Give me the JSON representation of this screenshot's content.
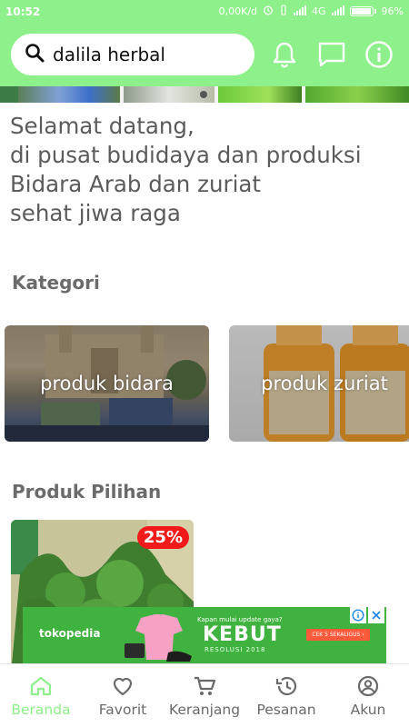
{
  "status_bar": {
    "time": "10:52",
    "network_speed": "0,00K/d",
    "network_type": "4G",
    "battery": "96%",
    "battery_level": 0.96
  },
  "app_bar": {
    "search_value": "dalila herbal",
    "icons": [
      "search-icon",
      "bell-icon",
      "chat-icon",
      "info-icon"
    ]
  },
  "welcome_text": "Selamat datang,\ndi pusat budidaya dan produksi\nBidara Arab dan zuriat\nsehat jiwa raga",
  "kategori": {
    "title": "Kategori",
    "items": [
      {
        "label": "produk bidara"
      },
      {
        "label": "produk zuriat"
      }
    ]
  },
  "produk_pilihan": {
    "title": "Produk Pilihan",
    "items": [
      {
        "discount": "25%"
      }
    ]
  },
  "ad": {
    "brand": "tokopedia",
    "tagline_small": "Kapan mulai update gaya?",
    "headline": "KEBUT",
    "subline": "RESOLUSI 2018",
    "cta": "CEK 5 SEKALIGUS ›"
  },
  "bottom_nav": {
    "items": [
      {
        "label": "Beranda",
        "icon": "home-icon",
        "active": true
      },
      {
        "label": "Favorit",
        "icon": "heart-icon",
        "active": false
      },
      {
        "label": "Keranjang",
        "icon": "cart-icon",
        "active": false
      },
      {
        "label": "Pesanan",
        "icon": "history-icon",
        "active": false
      },
      {
        "label": "Akun",
        "icon": "account-icon",
        "active": false
      }
    ]
  },
  "colors": {
    "primary": "#8ef08a",
    "discount": "#f01a1a",
    "ad_background": "#3fb23f"
  }
}
